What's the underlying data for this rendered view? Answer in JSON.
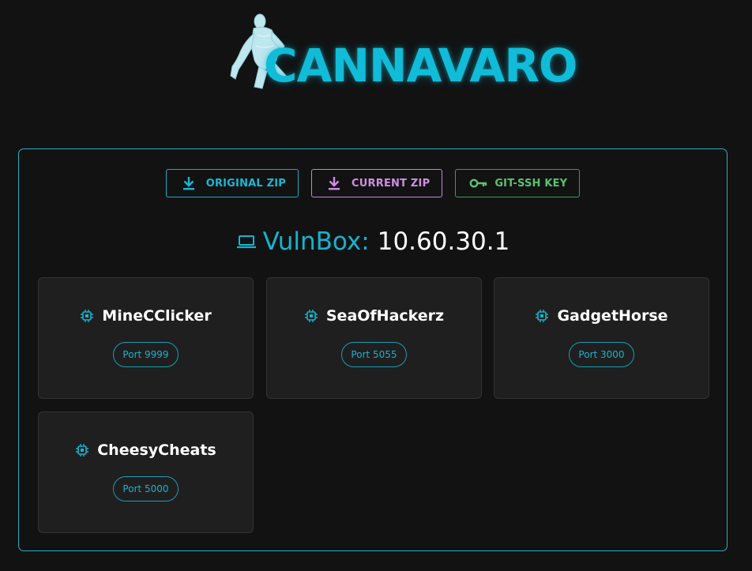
{
  "header": {
    "brand": "CANNAVARO",
    "logo_icon": "footballer-figure"
  },
  "downloads": [
    {
      "label": "ORIGINAL ZIP",
      "icon": "download-icon",
      "color": "#19b8d4"
    },
    {
      "label": "CURRENT ZIP",
      "icon": "download-icon",
      "color": "#cf8fe3"
    },
    {
      "label": "GIT-SSH KEY",
      "icon": "key-icon",
      "color": "#5bc272"
    }
  ],
  "vulnbox": {
    "label": "VulnBox:",
    "ip": "10.60.30.1",
    "icon": "laptop-icon"
  },
  "services": [
    {
      "name": "MineCClicker",
      "port": "Port 9999",
      "icon": "chip-icon"
    },
    {
      "name": "SeaOfHackerz",
      "port": "Port 5055",
      "icon": "chip-icon"
    },
    {
      "name": "GadgetHorse",
      "port": "Port 3000",
      "icon": "chip-icon"
    },
    {
      "name": "CheesyCheats",
      "port": "Port 5000",
      "icon": "chip-icon"
    }
  ],
  "colors": {
    "accent": "#10bcd8",
    "background": "#121212",
    "card": "#1f1f1f"
  }
}
